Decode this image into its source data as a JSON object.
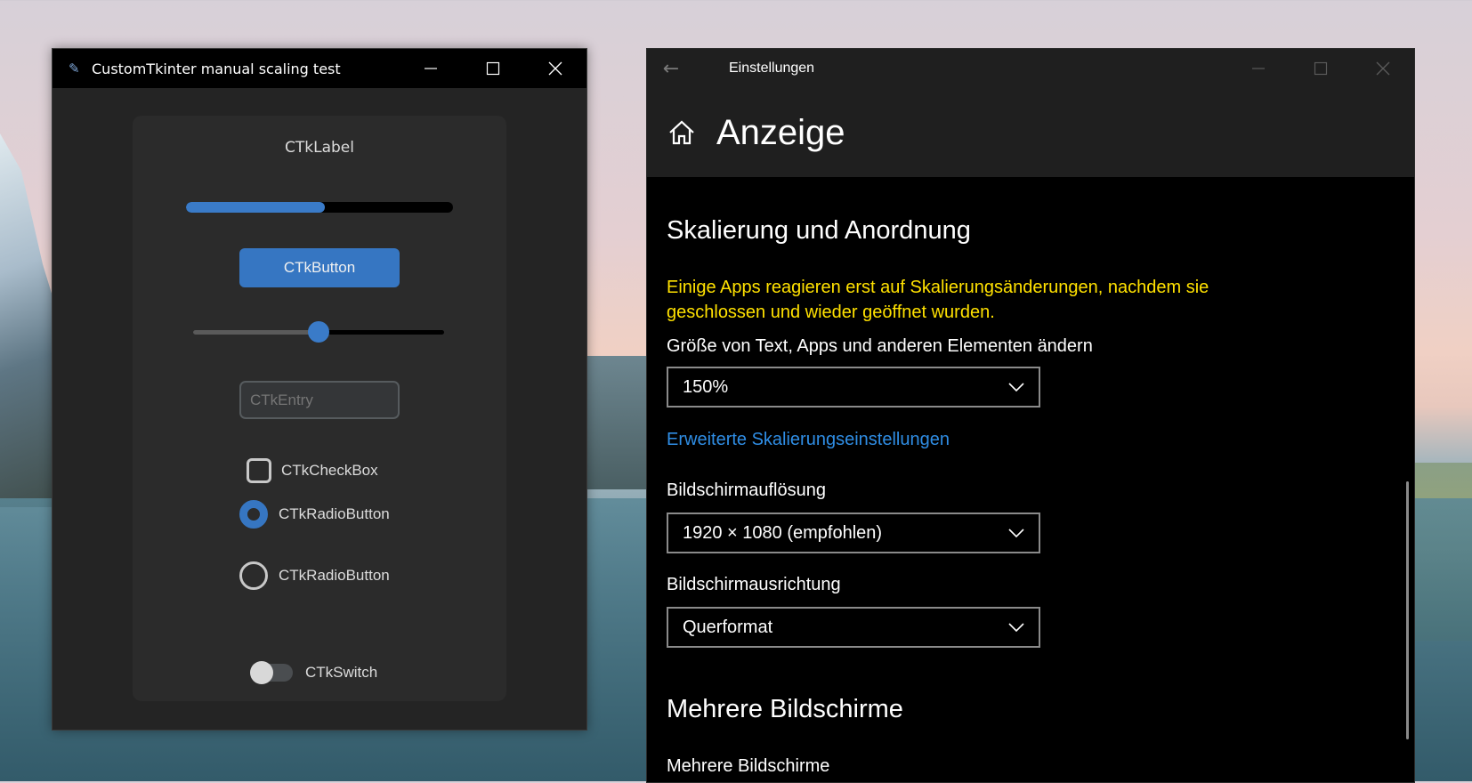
{
  "ctk_window": {
    "title": "CustomTkinter manual scaling test",
    "label": "CTkLabel",
    "progress": 0.52,
    "button_label": "CTkButton",
    "slider_value": 0.5,
    "entry_placeholder": "CTkEntry",
    "checkbox_label": "CTkCheckBox",
    "radio1_label": "CTkRadioButton",
    "radio2_label": "CTkRadioButton",
    "switch_label": "CTkSwitch"
  },
  "settings_window": {
    "title": "Einstellungen",
    "page_title": "Anzeige",
    "section1_title": "Skalierung und Anordnung",
    "warning": "Einige Apps reagieren erst auf Skalierungsänderungen, nachdem sie geschlossen und wieder geöffnet wurden.",
    "scale_label": "Größe von Text, Apps und anderen Elementen ändern",
    "scale_value": "150%",
    "advanced_link": "Erweiterte Skalierungseinstellungen",
    "resolution_label": "Bildschirmauflösung",
    "resolution_value": "1920 × 1080 (empfohlen)",
    "orientation_label": "Bildschirmausrichtung",
    "orientation_value": "Querformat",
    "section2_title": "Mehrere Bildschirme",
    "multi_label": "Mehrere Bildschirme"
  },
  "colors": {
    "accent": "#3676c2",
    "warning": "#ffe100",
    "link": "#2f8de4"
  }
}
